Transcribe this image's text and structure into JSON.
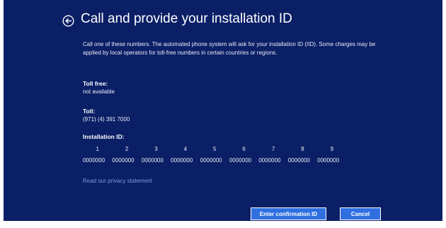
{
  "header": {
    "back_icon": "back-arrow-circle-icon",
    "title": "Call and provide your installation ID"
  },
  "description": "Call one of these numbers. The automated phone system will ask for your installation ID (IID). Some charges may be applied by local operators for toll-free numbers in certain countries or regions.",
  "toll_free": {
    "label": "Toll free:",
    "value": "not available"
  },
  "toll": {
    "label": "Toll:",
    "value": "(971) (4) 391 7000"
  },
  "installation_id": {
    "label": "Installation ID:",
    "columns": [
      "1",
      "2",
      "3",
      "4",
      "5",
      "6",
      "7",
      "8",
      "9"
    ],
    "groups": [
      "0000000",
      "0000000",
      "0000000",
      "0000000",
      "0000000",
      "0000000",
      "0000000",
      "0000000",
      "0000000"
    ]
  },
  "privacy_link": "Read our privacy statement",
  "buttons": {
    "enter_confirmation": "Enter confirmation ID",
    "cancel": "Cancel"
  },
  "colors": {
    "background": "#0b1f66",
    "button": "#2f6fe0",
    "link": "#7f97e6"
  }
}
